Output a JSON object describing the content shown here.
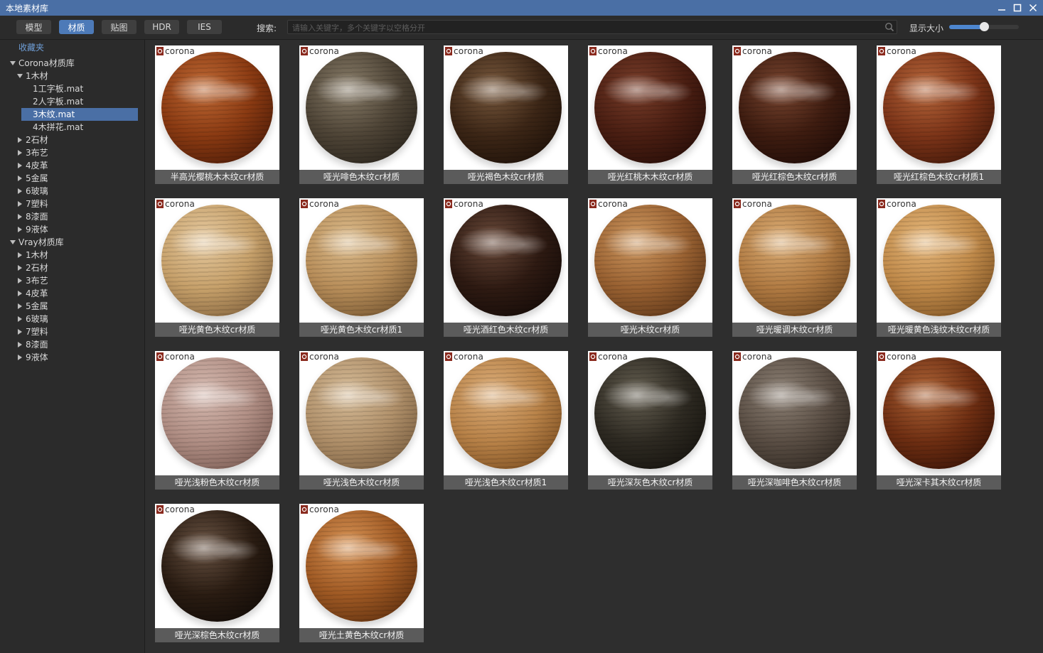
{
  "window": {
    "title": "本地素材库"
  },
  "toolbar": {
    "tabs": [
      {
        "label": "模型",
        "active": false
      },
      {
        "label": "材质",
        "active": true
      },
      {
        "label": "贴图",
        "active": false
      },
      {
        "label": "HDR",
        "active": false
      },
      {
        "label": "IES",
        "active": false
      }
    ],
    "search_label": "搜索:",
    "search_placeholder": "请输入关键字，多个关键字以空格分开",
    "size_label": "显示大小",
    "size_level": 0.5
  },
  "sidebar": {
    "favorites": "收藏夹",
    "corona_root": "Corona材质库",
    "corona_expanded": "1木材",
    "corona_files": [
      "1工字板.mat",
      "2人字板.mat",
      "3木纹.mat",
      "4木拼花.mat"
    ],
    "selected_file": "3木纹.mat",
    "corona_categories": [
      "2石材",
      "3布艺",
      "4皮革",
      "5金属",
      "6玻璃",
      "7塑料",
      "8漆面",
      "9液体"
    ],
    "vray_root": "Vray材质库",
    "vray_categories": [
      "1木材",
      "2石材",
      "3布艺",
      "4皮革",
      "5金属",
      "6玻璃",
      "7塑料",
      "8漆面",
      "9液体"
    ]
  },
  "materials": [
    {
      "name": "半高光樱桃木木纹cr材质",
      "badge": "corona",
      "base": "#8a3a12",
      "light": "#c06a35",
      "dark": "#3a1204"
    },
    {
      "name": "哑光啡色木纹cr材质",
      "badge": "corona",
      "base": "#4e4436",
      "light": "#8a7e6a",
      "dark": "#1e1a14"
    },
    {
      "name": "哑光褐色木纹cr材质",
      "badge": "corona",
      "base": "#3c2616",
      "light": "#7a5a3e",
      "dark": "#140a04"
    },
    {
      "name": "哑光红桃木木纹cr材质",
      "badge": "corona",
      "base": "#4a1e12",
      "light": "#7a3e2a",
      "dark": "#1c0804"
    },
    {
      "name": "哑光红棕色木纹cr材质",
      "badge": "corona",
      "base": "#3e1c10",
      "light": "#7a4630",
      "dark": "#140604"
    },
    {
      "name": "哑光红棕色木纹cr材质1",
      "badge": "corona",
      "base": "#7c3418",
      "light": "#b8683c",
      "dark": "#2e0e04"
    },
    {
      "name": "哑光黄色木纹cr材质",
      "badge": "corona",
      "base": "#c6a06a",
      "light": "#e6caa0",
      "dark": "#6e5030"
    },
    {
      "name": "哑光黄色木纹cr材质1",
      "badge": "corona",
      "base": "#b88e5a",
      "light": "#dcbc8c",
      "dark": "#5e4222"
    },
    {
      "name": "哑光酒红色木纹cr材质",
      "badge": "corona",
      "base": "#2e1a12",
      "light": "#6a4a3a",
      "dark": "#0c0604"
    },
    {
      "name": "哑光木纹cr材质",
      "badge": "corona",
      "base": "#9a6232",
      "light": "#d09a62",
      "dark": "#4a2810"
    },
    {
      "name": "哑光暖调木纹cr材质",
      "badge": "corona",
      "base": "#b07a42",
      "light": "#dcae76",
      "dark": "#5a3614"
    },
    {
      "name": "哑光暖黄色浅纹木纹cr材质",
      "badge": "corona",
      "base": "#c08a4a",
      "light": "#e6b87c",
      "dark": "#6a4218"
    },
    {
      "name": "哑光浅粉色木纹cr材质",
      "badge": "corona",
      "base": "#b08e84",
      "light": "#d6bab0",
      "dark": "#6a4c44"
    },
    {
      "name": "哑光浅色木纹cr材质",
      "badge": "corona",
      "base": "#b0906a",
      "light": "#d6bc98",
      "dark": "#6a5034"
    },
    {
      "name": "哑光浅色木纹cr材质1",
      "badge": "corona",
      "base": "#b88248",
      "light": "#dcae7a",
      "dark": "#6a3e14"
    },
    {
      "name": "哑光深灰色木纹cr材质",
      "badge": "corona",
      "base": "#2e2a22",
      "light": "#666052",
      "dark": "#0e0c08"
    },
    {
      "name": "哑光深咖啡色木纹cr材质",
      "badge": "corona",
      "base": "#5a4e44",
      "light": "#8e8276",
      "dark": "#221c16"
    },
    {
      "name": "哑光深卡其木纹cr材质",
      "badge": "corona",
      "base": "#6e2e12",
      "light": "#b06638",
      "dark": "#260a02"
    },
    {
      "name": "哑光深棕色木纹cr材质",
      "badge": "corona",
      "base": "#2a1c12",
      "light": "#6a5444",
      "dark": "#0a0604"
    },
    {
      "name": "哑光土黄色木纹cr材质",
      "badge": "corona",
      "base": "#a05a24",
      "light": "#d89456",
      "dark": "#4a2208"
    }
  ]
}
